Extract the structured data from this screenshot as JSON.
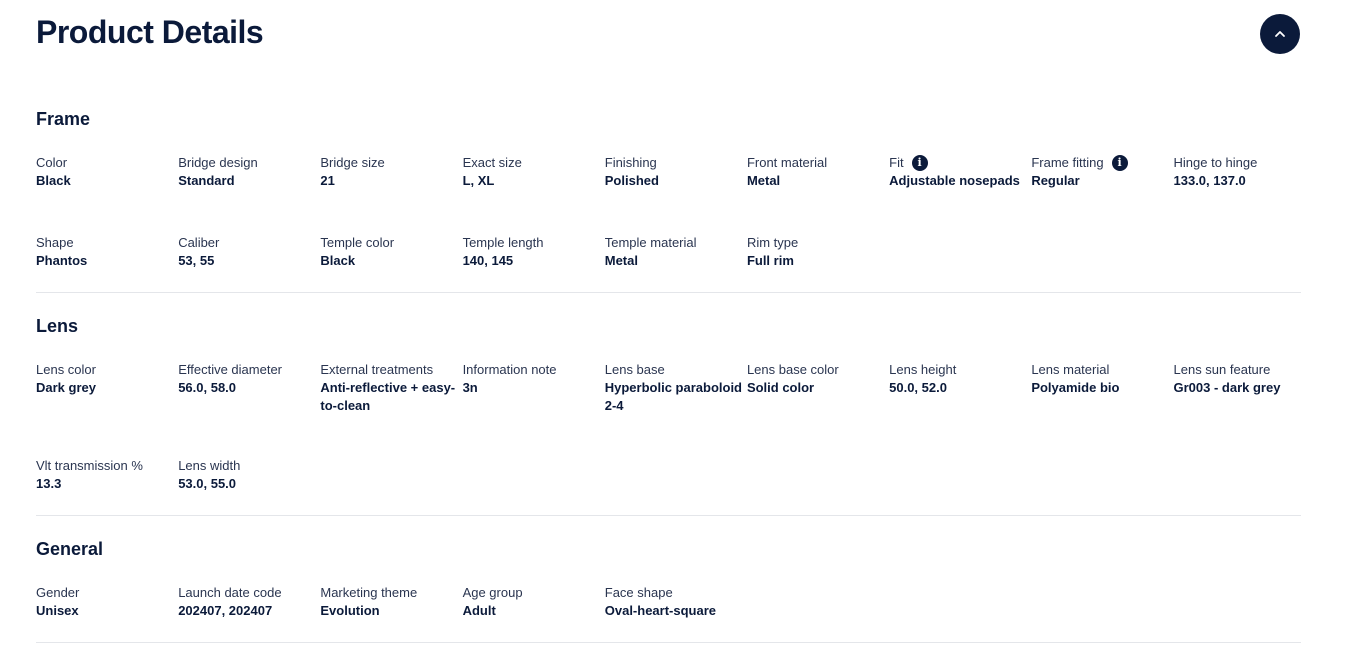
{
  "page": {
    "title": "Product Details"
  },
  "frame": {
    "title": "Frame",
    "items": [
      {
        "label": "Color",
        "value": "Black"
      },
      {
        "label": "Bridge design",
        "value": "Standard"
      },
      {
        "label": "Bridge size",
        "value": "21"
      },
      {
        "label": "Exact size",
        "value": "L, XL"
      },
      {
        "label": "Finishing",
        "value": "Polished"
      },
      {
        "label": "Front material",
        "value": "Metal"
      },
      {
        "label": "Fit",
        "value": "Adjustable nosepads"
      },
      {
        "label": "Frame fitting",
        "value": "Regular"
      },
      {
        "label": "Hinge to hinge",
        "value": "133.0, 137.0"
      },
      {
        "label": "Shape",
        "value": "Phantos"
      },
      {
        "label": "Caliber",
        "value": "53, 55"
      },
      {
        "label": "Temple color",
        "value": "Black"
      },
      {
        "label": "Temple length",
        "value": "140, 145"
      },
      {
        "label": "Temple material",
        "value": "Metal"
      },
      {
        "label": "Rim type",
        "value": "Full rim"
      }
    ]
  },
  "lens": {
    "title": "Lens",
    "items": [
      {
        "label": "Lens color",
        "value": "Dark grey"
      },
      {
        "label": "Effective diameter",
        "value": "56.0, 58.0"
      },
      {
        "label": "External treatments",
        "value": "Anti-reflective + easy-to-clean"
      },
      {
        "label": "Information note",
        "value": "3n"
      },
      {
        "label": "Lens base",
        "value": "Hyperbolic paraboloid 2-4"
      },
      {
        "label": "Lens base color",
        "value": "Solid color"
      },
      {
        "label": "Lens height",
        "value": "50.0, 52.0"
      },
      {
        "label": "Lens material",
        "value": "Polyamide bio"
      },
      {
        "label": "Lens sun feature",
        "value": "Gr003 - dark grey"
      },
      {
        "label": "Vlt transmission %",
        "value": "13.3"
      },
      {
        "label": "Lens width",
        "value": "53.0, 55.0"
      }
    ]
  },
  "general": {
    "title": "General",
    "items": [
      {
        "label": "Gender",
        "value": "Unisex"
      },
      {
        "label": "Launch date code",
        "value": "202407, 202407"
      },
      {
        "label": "Marketing theme",
        "value": "Evolution"
      },
      {
        "label": "Age group",
        "value": "Adult"
      },
      {
        "label": "Face shape",
        "value": "Oval-heart-square"
      }
    ]
  },
  "icons": {
    "collapse": "chevron-up-icon",
    "info": "info-icon"
  },
  "colors": {
    "primary": "#0b1a3a",
    "divider": "#e4e6ea"
  }
}
